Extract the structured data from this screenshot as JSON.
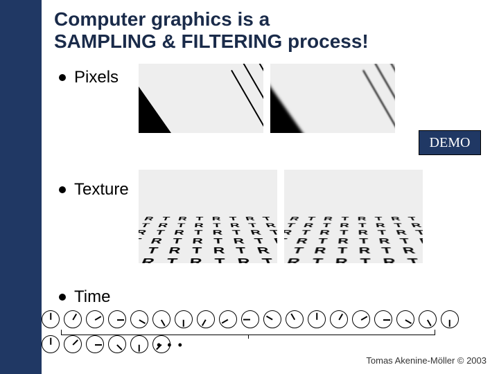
{
  "title_line1": "Computer graphics is a",
  "title_line2": "SAMPLING & FILTERING process!",
  "bullets": {
    "pixels": "Pixels",
    "texture": "Texture",
    "time": "Time"
  },
  "demo_label": "DEMO",
  "footer": "Tomas Akenine-Möller © 2003",
  "ellipsis": "• • •",
  "texture_glyphs": [
    "R",
    "T",
    "R",
    "T",
    "R",
    "T",
    "R",
    "T"
  ],
  "clock_angles_top": [
    270,
    300,
    330,
    0,
    30,
    60,
    90,
    120,
    150,
    180,
    210,
    240,
    270,
    300,
    330,
    0,
    30,
    60,
    90
  ],
  "clock_angles_bottom": [
    270,
    315,
    0,
    45,
    90,
    135
  ]
}
